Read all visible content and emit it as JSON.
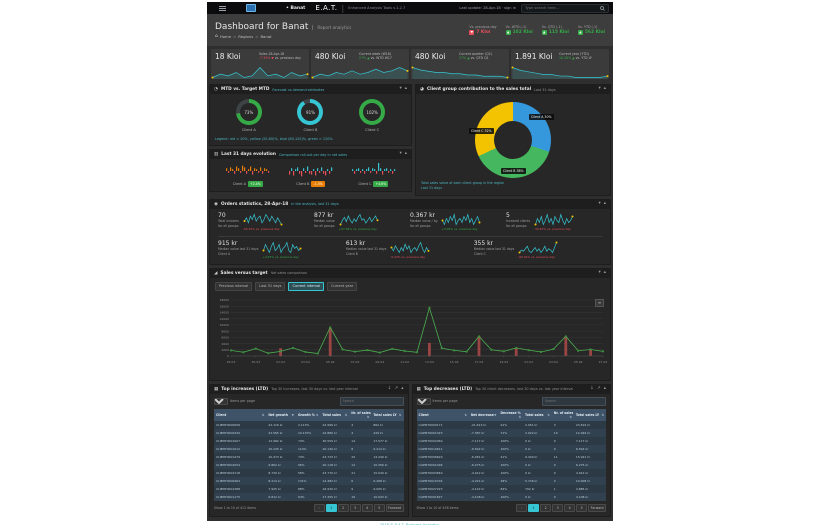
{
  "navbar": {
    "region": "Banat",
    "brand": "E.A.T.",
    "tagline": "Enhanced Analysis Tools   v.1.2.7",
    "status": "Last update: 28-Apr-18 · sign in",
    "search_placeholder": "Type search here..."
  },
  "header": {
    "title": "Dashboard for Banat",
    "subtitle": "Report analytics",
    "breadcrumb": [
      "Home",
      "Regions",
      "Banat"
    ],
    "stats": [
      {
        "label": "Vs. previous day",
        "value": "7 Kloi",
        "dir": "down",
        "color": "#e7505a"
      },
      {
        "label": "Vs. WTD (-1)",
        "value": "102 Kloi",
        "dir": "up",
        "color": "#35aa47"
      },
      {
        "label": "Vs. QTD (-1)",
        "value": "115 Kloi",
        "dir": "up",
        "color": "#35aa47"
      },
      {
        "label": "Vs. YTD (-1)",
        "value": "562 Kloi",
        "dir": "up",
        "color": "#35aa47"
      }
    ]
  },
  "kpis": [
    {
      "value": "18 Kloi",
      "caption": "Sales 28-Apr-18",
      "delta": "-7.34%",
      "dir": "down",
      "suffix": "vs. previous day"
    },
    {
      "value": "480 Kloi",
      "caption": "Current week (W18)",
      "delta": "27%",
      "dir": "up",
      "suffix": "vs. WTD W17"
    },
    {
      "value": "480 Kloi",
      "caption": "Current quarter (Q2)",
      "delta": "27%",
      "dir": "up",
      "suffix": "vs. QTD Q1"
    },
    {
      "value": "1.891 Kloi",
      "caption": "Current year (YTD)",
      "delta": "18.26%",
      "dir": "up",
      "suffix": "vs. YTD LY"
    }
  ],
  "mtd": {
    "title": "MTD vs. Target MTD",
    "subtitle": "Forecast vs demand estimates",
    "gauges": [
      {
        "label": "Client A",
        "pct": 73,
        "color": "#35aa47"
      },
      {
        "label": "Client B",
        "pct": 91,
        "color": "#36c6d3"
      },
      {
        "label": "Client C",
        "pct": 102,
        "color": "#35aa47"
      }
    ],
    "legend": "Legend: red < 20%, yellow (20-80)%, blue (80-120)%, green > 120%"
  },
  "contribution": {
    "title": "Client group contribution to the sales total",
    "subtitle": "Last 31 days",
    "footnote1": "Total sales value of each client group in the region",
    "footnote2": "Last 31 days"
  },
  "evolution": {
    "title": "Last 31 days evolution",
    "subtitle": "Comparison roll-out per day in net sales",
    "charts": [
      {
        "label": "Client A",
        "badge": "+2.4%",
        "badge_color": "#35aa47",
        "pos_color": "#e87e04",
        "neg_color": "#e7505a"
      },
      {
        "label": "Client B",
        "badge": "-1.3%",
        "badge_color": "#e87e04",
        "pos_color": "#36c6d3",
        "neg_color": "#e7505a"
      },
      {
        "label": "Client C",
        "badge": "+4.6%",
        "badge_color": "#35aa47",
        "pos_color": "#36c6d3",
        "neg_color": "#e7505a"
      }
    ]
  },
  "orders": {
    "title": "Orders statistics, 28-Apr-18",
    "subtitle": "In the analysis, last 31 days",
    "row1": [
      {
        "value": "70",
        "line1": "Total invoices",
        "line2": "for all groups",
        "delta": "-55.32% vs. previous day",
        "delta_color": "#e7505a",
        "spark": 0
      },
      {
        "value": "877 kr",
        "line1": "Median value",
        "line2": "for all groups",
        "delta": "+27.84% vs. previous day",
        "delta_color": "#35aa47",
        "spark": 1
      },
      {
        "value": "0.367 kr",
        "line1": "Median value / kg",
        "line2": "for all groups",
        "delta": "+3.05% vs. previous day",
        "delta_color": "#35aa47",
        "spark": 2
      },
      {
        "value": "5",
        "line1": "Invoiced clients",
        "line2": "for all groups",
        "delta": "-16.67% vs. previous day",
        "delta_color": "#e7505a",
        "spark": 3
      }
    ],
    "row2": [
      {
        "value": "915 kr",
        "line1": "Median value last 31 days",
        "line2": "Client A",
        "delta": "+4.25% vs. previous day",
        "delta_color": "#35aa47",
        "spark": 4
      },
      {
        "value": "613 kr",
        "line1": "Median value last 31 days",
        "line2": "Client B",
        "delta": "-5.22% vs. previous day",
        "delta_color": "#e7505a",
        "spark": 5
      },
      {
        "value": "355 kr",
        "line1": "Median value last 31 days",
        "line2": "Client C",
        "delta": "-60.91% vs. previous day",
        "delta_color": "#e7505a",
        "spark": 6
      }
    ]
  },
  "sales": {
    "title": "Sales versus target",
    "subtitle": "Net sales comparison",
    "buttons": [
      "Previous interval",
      "Last 31 days",
      "Current interval",
      "Current year"
    ],
    "active_button": "Current interval"
  },
  "tables": [
    {
      "title": "Top increases (LTD)",
      "subtitle": "Top 30 increases, last 30 days vs. last year interval",
      "page_size": "10",
      "page_size_label": "items per page",
      "search_placeholder": "Search",
      "headers": [
        "Client",
        "Net growth",
        "Growth %",
        "Total sales",
        "Nr. of sales",
        "Total sales LY"
      ],
      "rows": [
        [
          "CLIENT0000656",
          "22.116 kr",
          "2.113%",
          "22.996 kr",
          "4",
          "862 kr"
        ],
        [
          "CLIENT0000430",
          "22.565 kr",
          "10.170%",
          "22.880 kr",
          "4",
          "229 kr"
        ],
        [
          "CLIENT0001007",
          "12.982 kr",
          "74%",
          "30.559 kr",
          "14",
          "17.577 kr"
        ],
        [
          "CLIENT0001012",
          "10.245 kr",
          "110%",
          "20.140 kr",
          "8",
          "9.214 kr"
        ],
        [
          "CLIENT0001279",
          "10.473 kr",
          "74%",
          "24.723 kr",
          "29",
          "14.249 kr"
        ],
        [
          "CLIENT0002054",
          "9.862 kr",
          "96%",
          "20.118 kr",
          "12",
          "10.256 kr"
        ],
        [
          "CLIENT0003118",
          "8.730 kr",
          "58%",
          "23.770 kr",
          "21",
          "15.040 kr"
        ],
        [
          "CLIENT0000964",
          "8.214 kr",
          "131%",
          "14.482 kr",
          "6",
          "6.268 kr"
        ],
        [
          "CLIENT0001388",
          "7.925 kr",
          "88%",
          "16.930 kr",
          "9",
          "9.005 kr"
        ],
        [
          "CLIENT0001175",
          "6.812 kr",
          "64%",
          "17.455 kr",
          "16",
          "10.643 kr"
        ]
      ],
      "footer_info": "Show 1 to 10 of 412 items",
      "pagination": {
        "prev": "«",
        "pages": [
          "1",
          "2",
          "3",
          "4",
          "5"
        ],
        "active": "1",
        "next": "Forward"
      }
    },
    {
      "title": "Top decreases (LTD)",
      "subtitle": "Top 30 client decreases, last 30 days vs. last year interval",
      "page_size": "10",
      "page_size_label": "items per page",
      "search_placeholder": "Search",
      "headers": [
        "Client",
        "Net decrease",
        "Decrease %",
        "Total sales",
        "Nr. of sales",
        "Total sales LY"
      ],
      "rows": [
        [
          "CLIENT0000171",
          "-21.613 kr",
          "91%",
          "2.051 kr",
          "3",
          "23.619 kr"
        ],
        [
          "CLIENT0001323",
          "-7.387 kr",
          "71%",
          "2.922 kr",
          "10",
          "12.049 kr"
        ],
        [
          "CLIENT0002460",
          "-7.117 kr",
          "100%",
          "0 kr",
          "0",
          "7.117 kr"
        ],
        [
          "CLIENT0010611",
          "-6.592 kr",
          "100%",
          "0 kr",
          "0",
          "6.592 kr"
        ],
        [
          "CLIENT0006629",
          "-6.481 kr",
          "41%",
          "9.440 kr",
          "11",
          "15.921 kr"
        ],
        [
          "CLIENT0001496",
          "-6.275 kr",
          "100%",
          "0 kr",
          "0",
          "6.275 kr"
        ],
        [
          "CLIENT0003840",
          "-4.912 kr",
          "100%",
          "0 kr",
          "0",
          "4.912 kr"
        ],
        [
          "CLIENT0010794",
          "-4.221 kr",
          "28%",
          "5.746 kr",
          "4",
          "10.008 kr"
        ],
        [
          "CLIENT0007223",
          "-4.122 kr",
          "84%",
          "792 kr",
          "1",
          "4.885 kr"
        ],
        [
          "CLIENT0001827",
          "-4.108 kr",
          "100%",
          "0 kr",
          "0",
          "4.108 kr"
        ]
      ],
      "footer_info": "Show 1 to 10 of 458 items",
      "pagination": {
        "prev": "«",
        "pages": [
          "1",
          "2",
          "3",
          "4",
          "5"
        ],
        "active": "1",
        "next": "Forward"
      }
    }
  ],
  "page_footer": "2018 © E.A.T. Business Analytics.",
  "icons": {
    "home": "⌂",
    "caret_down": "▾",
    "collapse": "▴",
    "expand": "↗",
    "download": "↓",
    "sort": "⇅",
    "sort_desc": "▼",
    "up_arrow": "▲",
    "down_arrow": "▼",
    "menu_lines": "≡",
    "export": "≡",
    "panel_mtd": "◔",
    "panel_pie": "◕",
    "panel_bars": "▥",
    "panel_orders": "◉",
    "panel_chart": "◢",
    "panel_table": "▦"
  },
  "chart_data": [
    {
      "id": "kpi-sparklines",
      "type": "area",
      "series": [
        {
          "name": "Sales 28-Apr-18",
          "values": [
            3,
            5,
            4,
            6,
            3,
            4,
            9,
            4,
            5,
            3,
            6,
            4,
            5
          ]
        },
        {
          "name": "Current week (W18)",
          "values": [
            4,
            6,
            5,
            7,
            6,
            8,
            6,
            7,
            9,
            7,
            8,
            10,
            8
          ]
        },
        {
          "name": "Current quarter (Q2)",
          "values": [
            10,
            8,
            7,
            6,
            6,
            5,
            5,
            4,
            4,
            3,
            3,
            3,
            2
          ]
        },
        {
          "name": "Current year (YTD)",
          "values": [
            9,
            7,
            6,
            5,
            4,
            4,
            3,
            3,
            2,
            2,
            2,
            2,
            3
          ]
        }
      ]
    },
    {
      "id": "mtd-gauges",
      "type": "pie",
      "labels": [
        "Client A",
        "Client B",
        "Client C"
      ],
      "values": [
        73,
        91,
        102
      ]
    },
    {
      "id": "client-group-donut",
      "type": "pie",
      "labels": [
        "Client A",
        "Client B",
        "Client C"
      ],
      "values": [
        30,
        38,
        32
      ],
      "colors": [
        "#3598dc",
        "#45b75e",
        "#f3c200"
      ],
      "slice_labels": [
        "Client A 30%",
        "Client B 38%",
        "Client C 32%"
      ]
    },
    {
      "id": "evolution-bars",
      "type": "bar",
      "series": [
        {
          "name": "Client A",
          "values": [
            2,
            -1,
            3,
            1,
            -2,
            4,
            2,
            -1,
            5,
            3,
            -2,
            1,
            4,
            -3,
            2,
            1,
            -1,
            3,
            -2,
            2,
            1,
            -1
          ]
        },
        {
          "name": "Client B",
          "values": [
            -3,
            2,
            -4,
            1,
            3,
            -2,
            -5,
            2,
            -1,
            4,
            -2,
            -3,
            1,
            -4,
            2,
            -1,
            3,
            -2,
            -4,
            1,
            -2,
            3
          ]
        },
        {
          "name": "Client C",
          "values": [
            1,
            -2,
            1,
            2,
            -1,
            1,
            -2,
            1,
            3,
            -1,
            2,
            1,
            -2,
            8,
            2,
            -3,
            1,
            2,
            -1,
            1,
            -2,
            1
          ]
        }
      ]
    },
    {
      "id": "orders-sparklines",
      "type": "line",
      "series": [
        {
          "name": "Total invoices",
          "values": [
            5,
            7,
            4,
            8,
            6,
            9,
            5,
            7,
            8,
            4,
            6,
            9,
            7,
            5,
            8,
            6,
            4,
            7,
            5,
            3
          ]
        },
        {
          "name": "Median value",
          "values": [
            3,
            6,
            8,
            5,
            9,
            6,
            4,
            7,
            5,
            8,
            10,
            6,
            7,
            4,
            6,
            8,
            5,
            7,
            9,
            6
          ]
        },
        {
          "name": "Median value/kg",
          "values": [
            6,
            4,
            7,
            5,
            8,
            6,
            9,
            4,
            6,
            7,
            5,
            8,
            6,
            9,
            5,
            7,
            4,
            6,
            8,
            5
          ]
        },
        {
          "name": "Invoiced clients",
          "values": [
            4,
            7,
            5,
            8,
            4,
            6,
            9,
            5,
            7,
            4,
            8,
            6,
            5,
            9,
            6,
            4,
            7,
            5,
            6,
            8
          ]
        },
        {
          "name": "Client A",
          "values": [
            5,
            8,
            6,
            4,
            7,
            9,
            5,
            6,
            8,
            4,
            6,
            7,
            9,
            5,
            4,
            8,
            6,
            7,
            5,
            6
          ]
        },
        {
          "name": "Client B",
          "values": [
            7,
            5,
            8,
            6,
            4,
            7,
            5,
            9,
            6,
            8,
            4,
            6,
            7,
            5,
            8,
            10,
            6,
            4,
            7,
            5
          ]
        },
        {
          "name": "Client C",
          "values": [
            4,
            6,
            5,
            7,
            9,
            5,
            4,
            6,
            8,
            5,
            7,
            4,
            6,
            9,
            5,
            7,
            6,
            4,
            8,
            12
          ]
        }
      ]
    },
    {
      "id": "sales-versus-target",
      "type": "line",
      "ylim": [
        0,
        18000
      ],
      "y_ticks": [
        "18000",
        "16000",
        "14000",
        "12000",
        "10000",
        "8000",
        "6000",
        "4000",
        "2000",
        "0"
      ],
      "x_ticks": [
        "28-03",
        "30-03",
        "01-04",
        "03-04",
        "05-04",
        "07-04",
        "09-04",
        "11-04",
        "13-04",
        "15-04",
        "17-04",
        "19-04",
        "21-04",
        "23-04",
        "25-04",
        "27-04"
      ],
      "series": [
        {
          "name": "Sales",
          "type": "line",
          "color": "#4caf50",
          "values": [
            1800,
            1200,
            2400,
            900,
            1500,
            2600,
            1300,
            800,
            9200,
            2100,
            1400,
            1900,
            1100,
            2300,
            1600,
            1200,
            15500,
            2500,
            1800,
            1400,
            6300,
            2000,
            1500,
            2600,
            1900,
            1300,
            2200,
            6300,
            1700,
            2100,
            1500
          ]
        },
        {
          "name": "Target gap",
          "type": "bar",
          "color": "#b04a4a",
          "values": [
            0,
            0,
            0,
            0,
            2500,
            0,
            0,
            0,
            9000,
            0,
            0,
            0,
            0,
            0,
            0,
            0,
            4200,
            0,
            0,
            0,
            6400,
            0,
            0,
            2500,
            0,
            0,
            0,
            6300,
            0,
            2000,
            0
          ]
        }
      ]
    }
  ]
}
